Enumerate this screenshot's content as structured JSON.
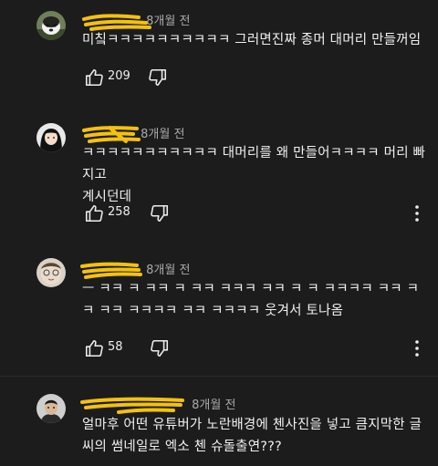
{
  "comments": [
    {
      "time": "8개월 전",
      "text": "미칰ㅋㅋㅋㅋㅋㅋㅋㅋㅋㅋ 그러면진짜 종머 대머리 만들꺼임",
      "likes": "209",
      "avatar": "dog-avatar"
    },
    {
      "time": "8개월 전",
      "text": "ㅋㅋㅋㅋㅋㅋㅋㅋㅋㅋㅋ 대머리를 왜 만들어ㅋㅋㅋㅋ 머리 빠지고\n계시던데",
      "likes": "258",
      "avatar": "girl-avatar"
    },
    {
      "time": "8개월 전",
      "text": "ㅡ ㅋㅋ ㅋ ㅋㅋ ㅋ ㅋㅋ ㅋㅋㅋ ㅋㅋ ㅋ ㅋ ㅋㅋㅋㅋ ㅋㅋ ㅋ\nㅋ ㅋㅋ ㅋㅋㅋㅋ ㅋㅋ ㅋㅋㅋㅋ 웃겨서 토나옴",
      "likes": "58",
      "avatar": "face-avatar"
    },
    {
      "time": "8개월 전",
      "text": "얼마후 어떤 유튜버가 노란배경에 첸사진을 넣고 큼지막한 글\n씨의 썸네일로 엑소 첸 슈돌출연???",
      "likes": "",
      "avatar": "man-avatar"
    }
  ],
  "colors": {
    "background": "#1c1c1c",
    "scribble": "#f4c20d",
    "text": "#f1f1f1",
    "meta": "#aaaaaa"
  }
}
